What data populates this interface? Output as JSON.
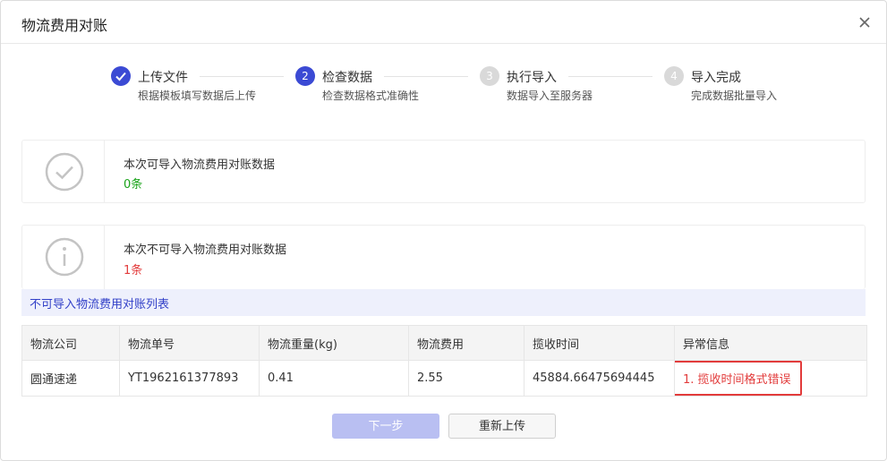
{
  "dialog": {
    "title": "物流费用对账"
  },
  "steps": [
    {
      "number": "",
      "label": "上传文件",
      "desc": "根据模板填写数据后上传",
      "state": "done"
    },
    {
      "number": "2",
      "label": "检查数据",
      "desc": "检查数据格式准确性",
      "state": "active"
    },
    {
      "number": "3",
      "label": "执行导入",
      "desc": "数据导入至服务器",
      "state": "pending"
    },
    {
      "number": "4",
      "label": "导入完成",
      "desc": "完成数据批量导入",
      "state": "pending"
    }
  ],
  "importable": {
    "title": "本次可导入物流费用对账数据",
    "count": "0条",
    "count_color": "#1aa31a"
  },
  "not_importable": {
    "title": "本次不可导入物流费用对账数据",
    "count": "1条",
    "count_color": "#e23b3b"
  },
  "error_list": {
    "title": "不可导入物流费用对账列表",
    "columns": [
      "物流公司",
      "物流单号",
      "物流重量(kg)",
      "物流费用",
      "揽收时间",
      "异常信息"
    ],
    "rows": [
      [
        "圆通速递",
        "YT1962161377893",
        "0.41",
        "2.55",
        "45884.66475694445",
        "1. 揽收时间格式错误"
      ]
    ]
  },
  "buttons": {
    "next": "下一步",
    "reupload": "重新上传"
  },
  "colors": {
    "primary": "#3b4ad4",
    "pending": "#d9d9d9",
    "error": "#e23b3b",
    "success": "#1aa31a"
  }
}
